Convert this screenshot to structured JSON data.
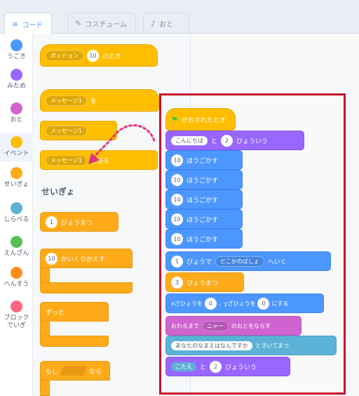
{
  "tabs": [
    {
      "label": "コード",
      "icon": "code-icon"
    },
    {
      "label": "コスチューム",
      "icon": "brush-icon"
    },
    {
      "label": "おと",
      "icon": "speaker-icon"
    }
  ],
  "categories": [
    {
      "label": "うごき",
      "color": "#4c97ff"
    },
    {
      "label": "みため",
      "color": "#9966ff"
    },
    {
      "label": "おと",
      "color": "#cf63cf"
    },
    {
      "label": "イベント",
      "color": "#ffbf00"
    },
    {
      "label": "せいぎょ",
      "color": "#ffab19"
    },
    {
      "label": "しらべる",
      "color": "#5cb1d6"
    },
    {
      "label": "えんざん",
      "color": "#59c059"
    },
    {
      "label": "へんすう",
      "color": "#ff8c1a"
    },
    {
      "label": "ブロックでいぎ",
      "color": "#ff6680"
    }
  ],
  "palette": {
    "event_block_key_dropdown": "ボッドョン",
    "event_block_key_value": "10",
    "event_block_key_text": "のとき",
    "message_block_1_dropdown": "メッセージ1",
    "message_block_1_text": "を",
    "message_block_2_dropdown": "メッセージ1",
    "message_block_3_dropdown": "メッセージ1",
    "message_block_3_text": "を送る",
    "section_control_title": "せいぎょ",
    "wait_value": "1",
    "wait_text": "びょうまつ",
    "repeat_value": "10",
    "repeat_text": "かいくりかえす",
    "forever_text": "ずっと",
    "if_text_a": "もし",
    "if_text_b": "なら"
  },
  "script": {
    "hat_text": "がおされたとき",
    "say_text_value": "こんにちは",
    "say_mid": "と",
    "say_secs": "2",
    "say_tail": "びょういう",
    "move_steps": "10",
    "move_text": "ほうごかす",
    "glide_secs": "1",
    "glide_text_a": "びょうで",
    "glide_dropdown": "どこかのばしょ",
    "glide_text_b": "へいく",
    "wait_secs": "3",
    "wait_text": "びょうまつ",
    "setxy_text_a": "xざひょうを",
    "setxy_x": "0",
    "setxy_text_b": "、yざひょうを",
    "setxy_y": "0",
    "setxy_text_c": "にする",
    "sound_text_a": "おわるまで",
    "sound_dropdown": "ニャー",
    "sound_text_b": "のおとをならす",
    "ask_value": "あなたのなまえはなんですか",
    "ask_text": "ときいてまつ",
    "say2_value": "こたえ",
    "say2_mid": "と",
    "say2_secs": "2",
    "say2_tail": "びょういう"
  }
}
